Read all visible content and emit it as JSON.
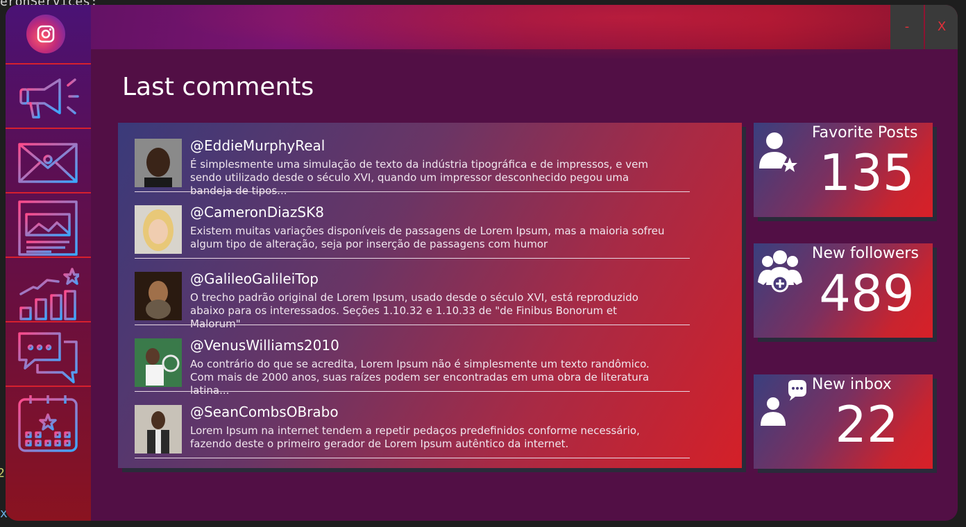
{
  "background_code": {
    "line1": "eronServices:",
    "line2": "2",
    "line3": "xt"
  },
  "window": {
    "minimize_label": "-",
    "close_label": "X"
  },
  "sidebar": {
    "items": [
      {
        "icon": "megaphone-icon"
      },
      {
        "icon": "mail-icon"
      },
      {
        "icon": "news-icon"
      },
      {
        "icon": "growth-chart-icon"
      },
      {
        "icon": "chat-icon"
      },
      {
        "icon": "calendar-icon"
      }
    ]
  },
  "main": {
    "title": "Last comments"
  },
  "comments": [
    {
      "handle": "@EddieMurphyReal",
      "text": "É simplesmente uma simulação de texto da indústria tipográfica e de impressos, e vem sendo utilizado desde o século XVI, quando um impressor desconhecido pegou uma bandeja de tipos..."
    },
    {
      "handle": "@CameronDiazSK8",
      "text": "Existem muitas variações disponíveis de passagens de Lorem Ipsum, mas a maioria sofreu algum tipo de alteração, seja por inserção de passagens com humor"
    },
    {
      "handle": "@GalileoGalileiTop",
      "text": "O trecho padrão original de Lorem Ipsum, usado desde o século XVI, está reproduzido abaixo para os interessados. Seções 1.10.32 e 1.10.33 de \"de Finibus Bonorum et Malorum\""
    },
    {
      "handle": "@VenusWilliams2010",
      "text": "Ao contrário do que se acredita, Lorem Ipsum não é simplesmente um texto randômico. Com mais de 2000 anos, suas raízes podem ser encontradas em uma obra de literatura latina..."
    },
    {
      "handle": "@SeanCombsOBrabo",
      "text": "Lorem Ipsum na internet tendem a repetir pedaços predefinidos conforme necessário, fazendo deste o primeiro gerador de Lorem Ipsum autêntico da internet."
    }
  ],
  "stats": [
    {
      "label": "Favorite Posts",
      "value": "135",
      "icon": "user-star-icon"
    },
    {
      "label": "New followers",
      "value": "489",
      "icon": "group-add-icon"
    },
    {
      "label": "New inbox",
      "value": "22",
      "icon": "user-message-icon"
    }
  ],
  "colors": {
    "accent_red": "#d6202e",
    "panel_bg": "#520f45",
    "icon_gradient_start": "#ff4a8a",
    "icon_gradient_end": "#3aa8ff"
  }
}
